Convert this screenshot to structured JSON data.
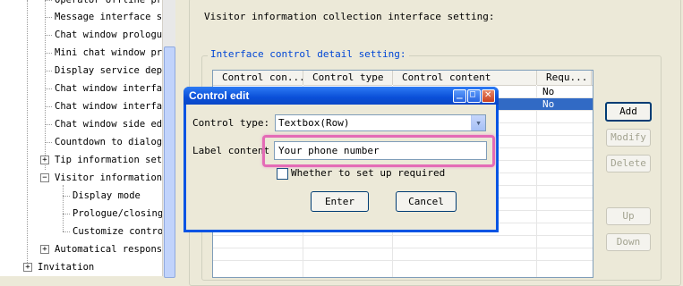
{
  "tree": {
    "items": [
      {
        "label": "Operator offline prompt"
      },
      {
        "label": "Message interface setting"
      },
      {
        "label": "Chat window prologue"
      },
      {
        "label": "Mini chat window prologue"
      },
      {
        "label": "Display service department"
      },
      {
        "label": "Chat window interface"
      },
      {
        "label": "Chat window interface"
      },
      {
        "label": "Chat window side edge"
      },
      {
        "label": "Countdown to dialog"
      },
      {
        "label": "Tip information setting"
      },
      {
        "label": "Visitor information"
      },
      {
        "label": "Display mode"
      },
      {
        "label": "Prologue/closing"
      },
      {
        "label": "Customize control"
      },
      {
        "label": "Automatical response"
      },
      {
        "label": "Invitation"
      }
    ],
    "exp_plus": "+",
    "exp_minus": "−"
  },
  "main": {
    "heading": "Visitor information collection interface setting:",
    "group_title": "Interface control detail setting:",
    "columns": [
      "Control con...",
      "Control type",
      "Control content",
      "Requ..."
    ],
    "rows": [
      {
        "required": "No"
      },
      {
        "required": "No"
      }
    ],
    "buttons": {
      "add": "Add",
      "modify": "Modify",
      "delete": "Delete",
      "up": "Up",
      "down": "Down"
    }
  },
  "dialog": {
    "title": "Control edit",
    "control_type_label": "Control type:",
    "control_type_value": "Textbox(Row)",
    "label_content_label": "Label content",
    "label_content_value": "Your phone number",
    "required_label": "Whether to set up required",
    "enter": "Enter",
    "cancel": "Cancel",
    "minimize_glyph": "_",
    "maximize_glyph": "□",
    "close_glyph": "✕",
    "dropdown_glyph": "▾"
  },
  "colors": {
    "highlight": "#e46bb6",
    "selection": "#316ac5",
    "titlebar": "#0054e3"
  }
}
